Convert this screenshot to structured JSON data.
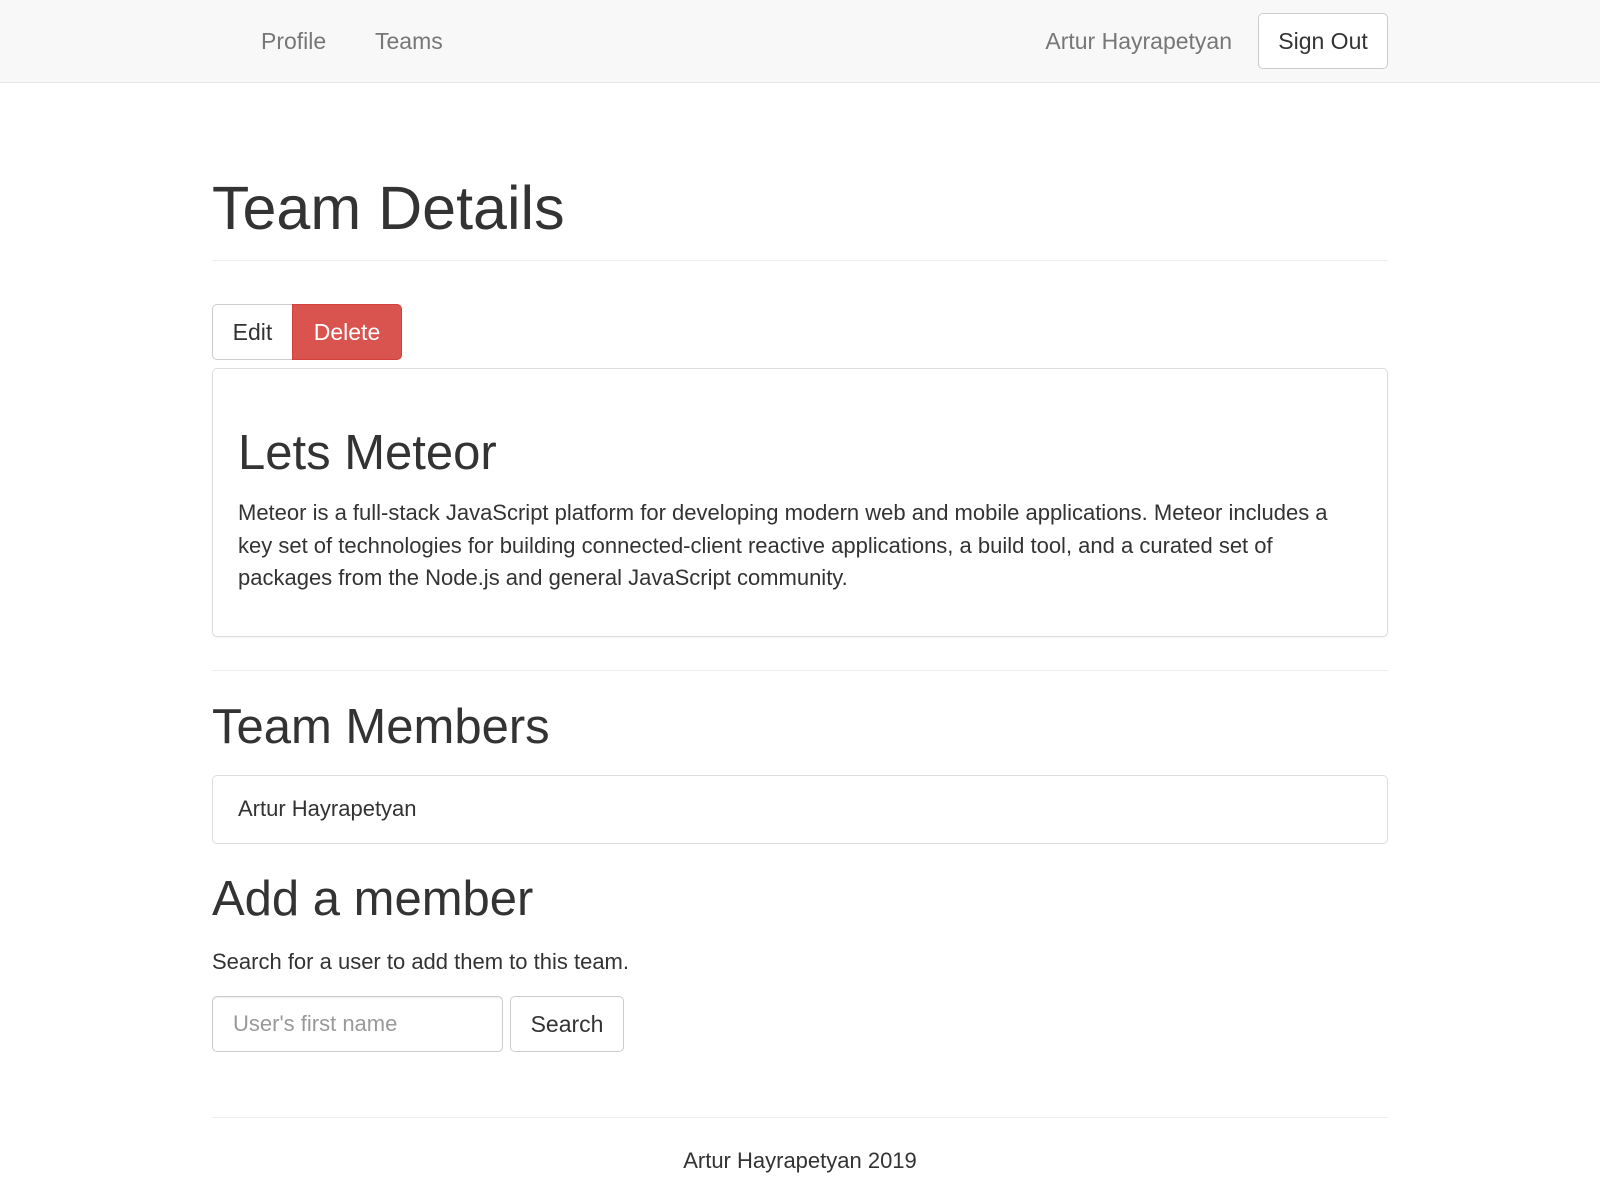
{
  "navbar": {
    "links": [
      {
        "label": "Profile"
      },
      {
        "label": "Teams"
      }
    ],
    "user_name": "Artur Hayrapetyan",
    "sign_out_label": "Sign Out"
  },
  "page": {
    "title": "Team Details",
    "actions": {
      "edit_label": "Edit",
      "delete_label": "Delete"
    }
  },
  "team": {
    "name": "Lets Meteor",
    "description": "Meteor is a full-stack JavaScript platform for developing modern web and mobile applications. Meteor includes a key set of technologies for building connected-client reactive applications, a build tool, and a curated set of packages from the Node.js and general JavaScript community."
  },
  "members": {
    "title": "Team Members",
    "items": [
      {
        "name": "Artur Hayrapetyan"
      }
    ]
  },
  "add_member": {
    "title": "Add a member",
    "help_text": "Search for a user to add them to this team.",
    "input_placeholder": "User's first name",
    "input_value": "",
    "search_label": "Search"
  },
  "footer": {
    "text": "Artur Hayrapetyan 2019"
  },
  "colors": {
    "danger": "#d9534f",
    "navbar_bg": "#f8f8f8",
    "nav_text": "#777777",
    "text": "#333333"
  }
}
